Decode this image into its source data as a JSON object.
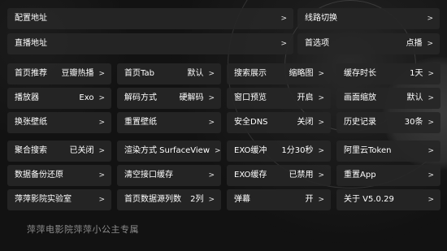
{
  "top": {
    "config_url": "配置地址",
    "line_switch": "线路切换",
    "live_url": "直播地址",
    "preferred_label": "首选项",
    "preferred_value": "点播"
  },
  "arrow": ">",
  "grid": [
    [
      {
        "label": "首页推荐",
        "value": "豆瓣热播"
      },
      {
        "label": "首页Tab",
        "value": "默认"
      },
      {
        "label": "搜索展示",
        "value": "缩略图"
      },
      {
        "label": "缓存时长",
        "value": "1天"
      }
    ],
    [
      {
        "label": "播放器",
        "value": "Exo"
      },
      {
        "label": "解码方式",
        "value": "硬解码"
      },
      {
        "label": "窗口预览",
        "value": "开启"
      },
      {
        "label": "画面缩放",
        "value": "默认"
      }
    ],
    [
      {
        "label": "换张壁纸",
        "value": ""
      },
      {
        "label": "重置壁纸",
        "value": ""
      },
      {
        "label": "安全DNS",
        "value": "关闭"
      },
      {
        "label": "历史记录",
        "value": "30条"
      }
    ],
    [
      {
        "label": "聚合搜索",
        "value": "已关闭"
      },
      {
        "label": "渲染方式 SurfaceView",
        "value": ""
      },
      {
        "label": "EXO缓冲",
        "value": "1分30秒"
      },
      {
        "label": "阿里云Token",
        "value": ""
      }
    ],
    [
      {
        "label": "数据备份还原",
        "value": ""
      },
      {
        "label": "清空接口缓存",
        "value": ""
      },
      {
        "label": "EXO缓存",
        "value": "已禁用"
      },
      {
        "label": "重置App",
        "value": ""
      }
    ],
    [
      {
        "label": "萍萍影院实验室",
        "value": ""
      },
      {
        "label": "首页数据源列数",
        "value": "2列"
      },
      {
        "label": "弹幕",
        "value": "开"
      },
      {
        "label": "关于  V5.0.29",
        "value": ""
      }
    ]
  ],
  "footer": "萍萍电影院萍萍小公主专属"
}
